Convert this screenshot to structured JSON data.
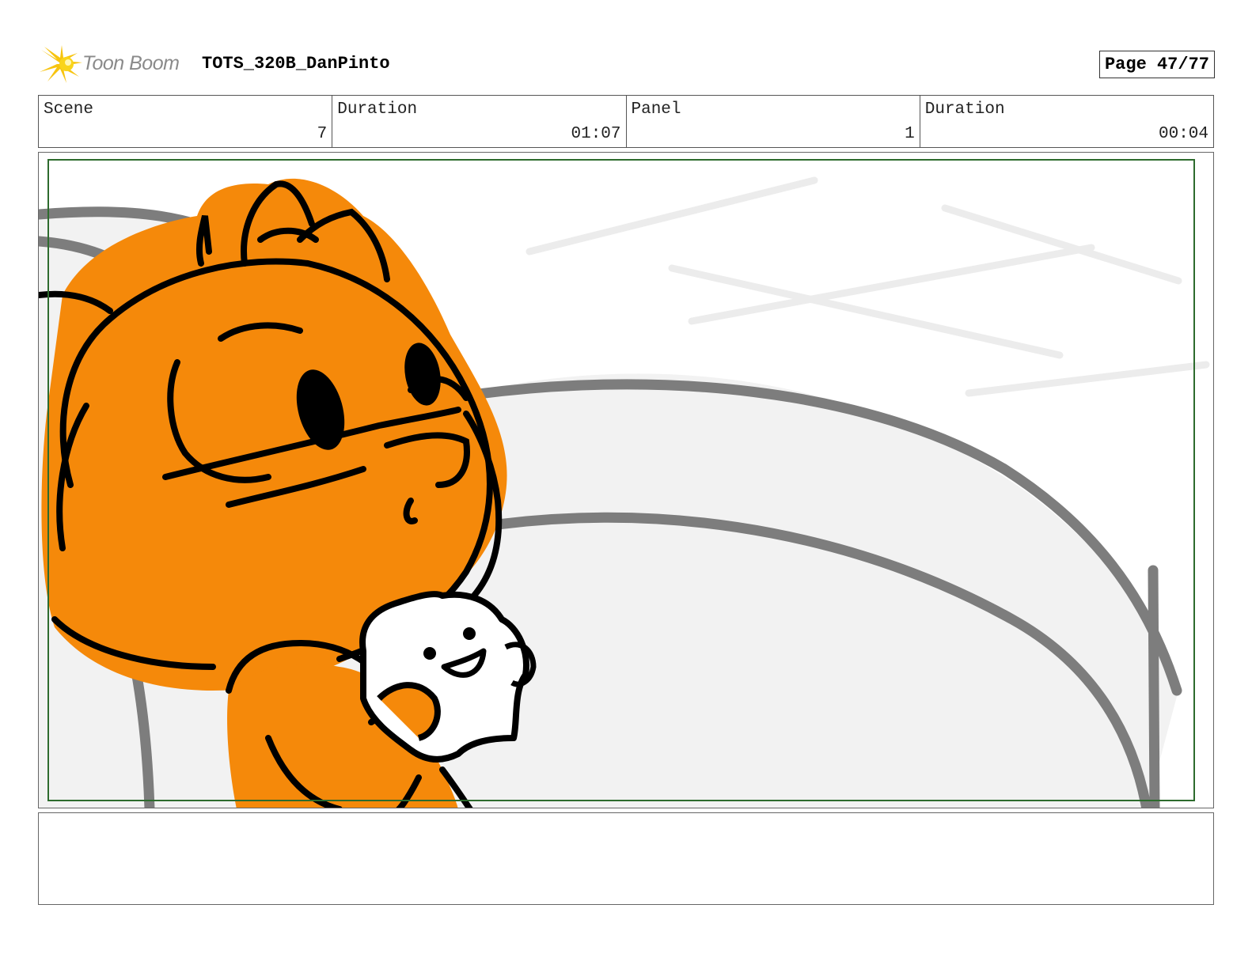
{
  "header": {
    "logo_text": "Toon Boom",
    "project_title": "TOTS_320B_DanPinto",
    "page_label": "Page 47/77"
  },
  "info": {
    "scene_label": "Scene",
    "scene_value": "7",
    "scene_duration_label": "Duration",
    "scene_duration_value": "01:07",
    "panel_label": "Panel",
    "panel_value": "1",
    "panel_duration_label": "Duration",
    "panel_duration_value": "00:04"
  },
  "colors": {
    "character_orange": "#f5890a",
    "safe_frame_green": "#2d6b2d",
    "background_gray": "#f2f2f2",
    "stroke_gray": "#7d7d7d"
  },
  "notes": {
    "text": ""
  }
}
